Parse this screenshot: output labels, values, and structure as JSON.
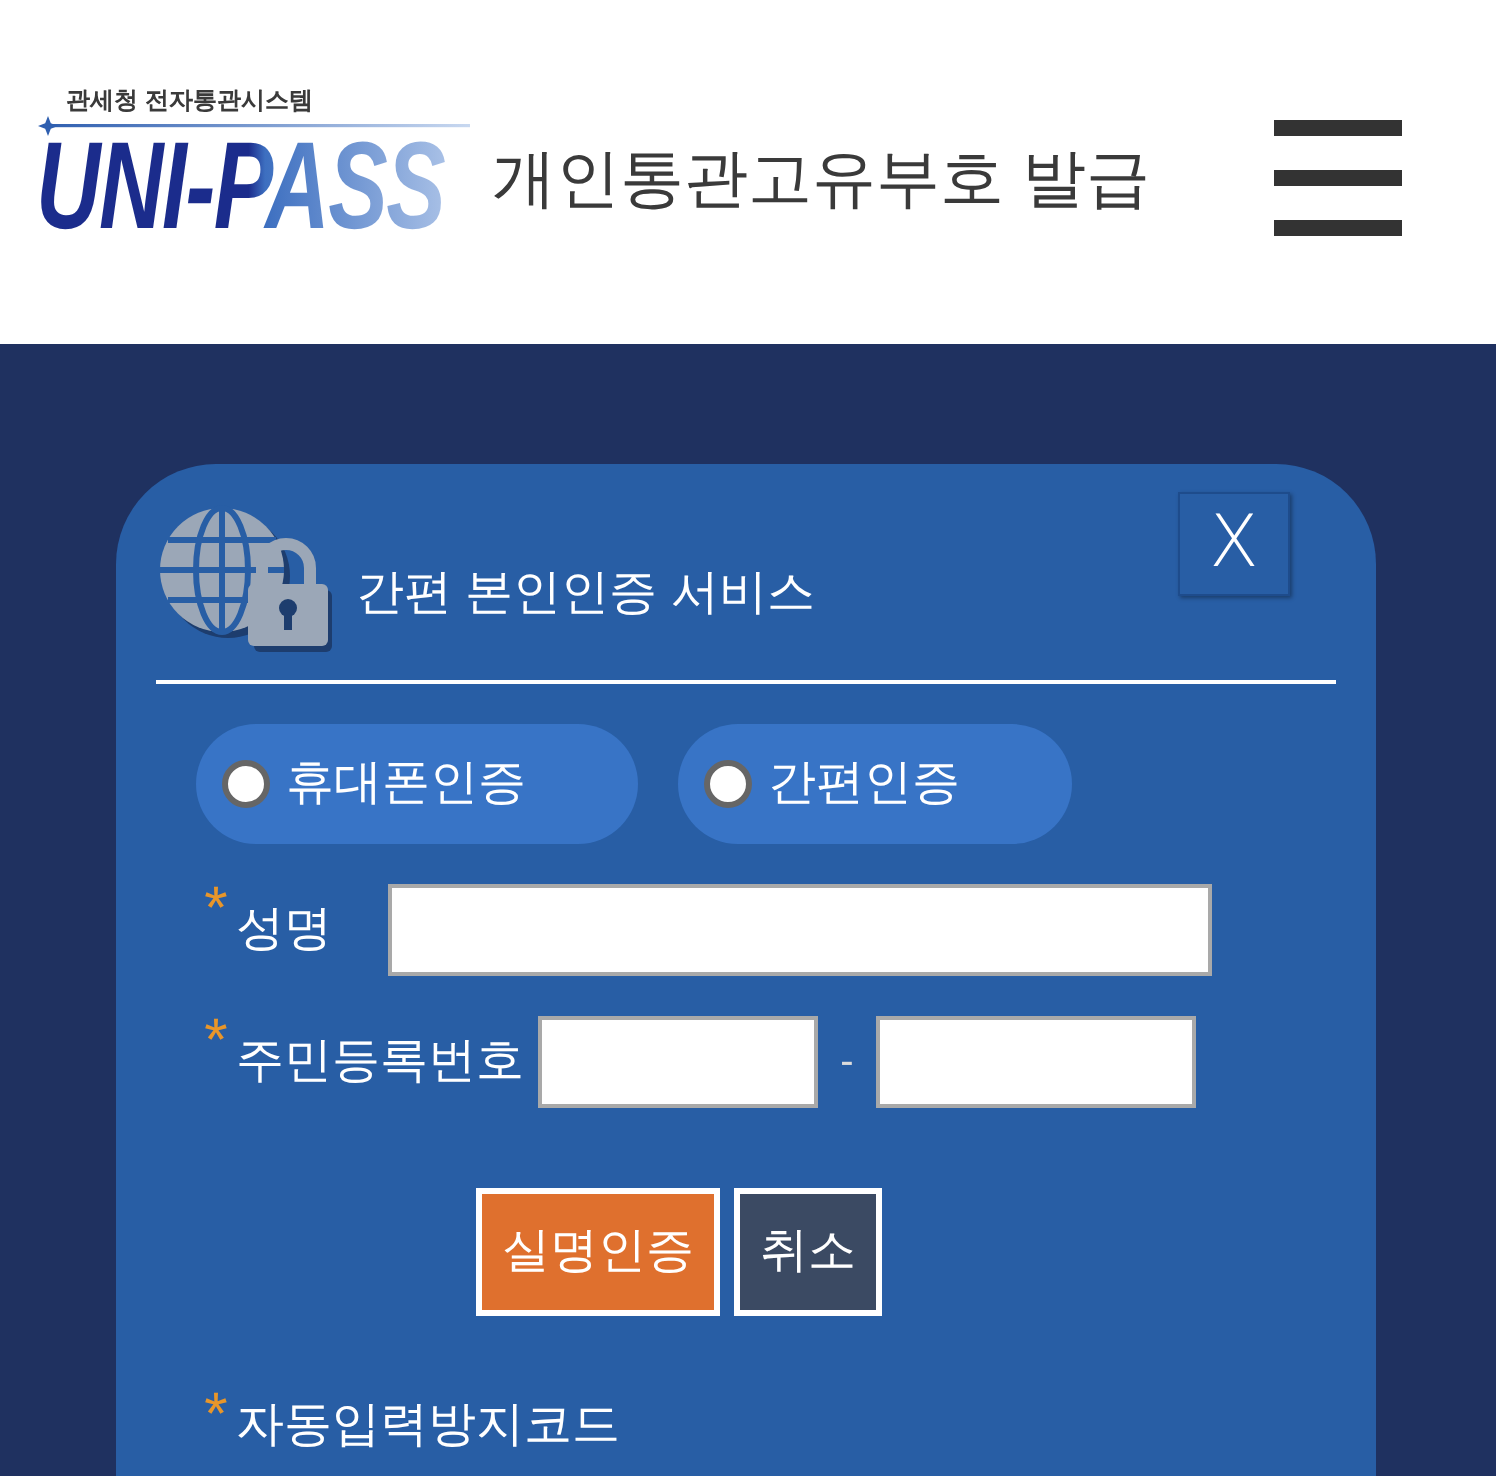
{
  "header": {
    "logo": {
      "subtitle": "관세청 전자통관시스템",
      "wordmark": "UNI-PASS"
    },
    "title": "개인통관고유부호 발급"
  },
  "dialog": {
    "title": "간편 본인인증 서비스",
    "close_label": "X",
    "auth_options": [
      {
        "label": "휴대폰인증",
        "selected": false
      },
      {
        "label": "간편인증",
        "selected": false
      }
    ],
    "fields": [
      {
        "kind": "single",
        "required_mark": "*",
        "label": "성명"
      },
      {
        "kind": "split",
        "required_mark": "*",
        "label": "주민등록번호",
        "separator": "-"
      }
    ],
    "buttons": [
      {
        "kind": "primary",
        "label": "실명인증"
      },
      {
        "kind": "secondary",
        "label": "취소"
      }
    ],
    "captcha": {
      "required_mark": "*",
      "label": "자동입력방지코드"
    }
  }
}
